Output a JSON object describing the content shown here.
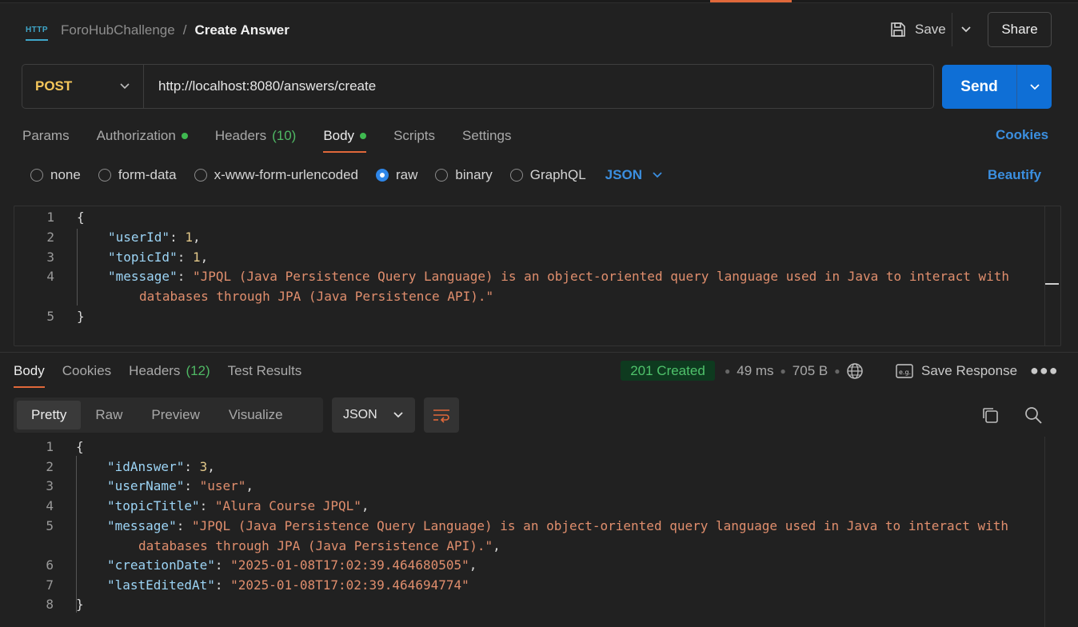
{
  "header": {
    "collection": "ForoHubChallenge",
    "separator": "/",
    "request_name": "Create Answer",
    "http_icon_text": "HTTP",
    "save_label": "Save",
    "share_label": "Share"
  },
  "request": {
    "method": "POST",
    "url": "http://localhost:8080/answers/create",
    "send_label": "Send"
  },
  "request_tabs": [
    {
      "label": "Params"
    },
    {
      "label": "Authorization",
      "dot": true
    },
    {
      "label": "Headers",
      "count": "(10)"
    },
    {
      "label": "Body",
      "dot": true,
      "active": true
    },
    {
      "label": "Scripts"
    },
    {
      "label": "Settings"
    }
  ],
  "cookies_label": "Cookies",
  "body_types": {
    "none": "none",
    "form_data": "form-data",
    "urlencoded": "x-www-form-urlencoded",
    "raw": "raw",
    "binary": "binary",
    "graphql": "GraphQL",
    "selected": "raw",
    "language": "JSON"
  },
  "beautify_label": "Beautify",
  "request_body": {
    "line_numbers": [
      "1",
      "2",
      "3",
      "4",
      "",
      "5"
    ],
    "open_brace": "{",
    "close_brace": "}",
    "userId_key": "\"userId\"",
    "userId_val": "1",
    "topicId_key": "\"topicId\"",
    "topicId_val": "1",
    "message_key": "\"message\"",
    "message_val_1": "\"JPQL (Java Persistence Query Language) is an object-oriented query language used in Java to interact with",
    "message_val_2": "databases through JPA (Java Persistence API).\""
  },
  "response_tabs": [
    {
      "label": "Body",
      "active": true
    },
    {
      "label": "Cookies"
    },
    {
      "label": "Headers",
      "count": "(12)"
    },
    {
      "label": "Test Results"
    }
  ],
  "response_meta": {
    "status": "201 Created",
    "time": "49 ms",
    "size": "705 B",
    "save_response": "Save Response"
  },
  "response_view": {
    "modes": [
      "Pretty",
      "Raw",
      "Preview",
      "Visualize"
    ],
    "active_mode": "Pretty",
    "format": "JSON"
  },
  "response_body": {
    "line_numbers": [
      "1",
      "2",
      "3",
      "4",
      "5",
      "",
      "6",
      "7",
      "8"
    ],
    "open_brace": "{",
    "close_brace": "}",
    "idAnswer_key": "\"idAnswer\"",
    "idAnswer_val": "3",
    "userName_key": "\"userName\"",
    "userName_val": "\"user\"",
    "topicTitle_key": "\"topicTitle\"",
    "topicTitle_val": "\"Alura Course JPQL\"",
    "message_key": "\"message\"",
    "message_val_1": "\"JPQL (Java Persistence Query Language) is an object-oriented query language used in Java to interact with",
    "message_val_2": "databases through JPA (Java Persistence API).\"",
    "creationDate_key": "\"creationDate\"",
    "creationDate_val": "\"2025-01-08T17:02:39.464680505\"",
    "lastEditedAt_key": "\"lastEditedAt\"",
    "lastEditedAt_val": "\"2025-01-08T17:02:39.464694774\""
  },
  "colors": {
    "accent": "#e0683a",
    "send": "#0f6fd6",
    "link": "#3b8fe0",
    "method": "#f5c75b",
    "status_ok": "#4fc26b"
  }
}
